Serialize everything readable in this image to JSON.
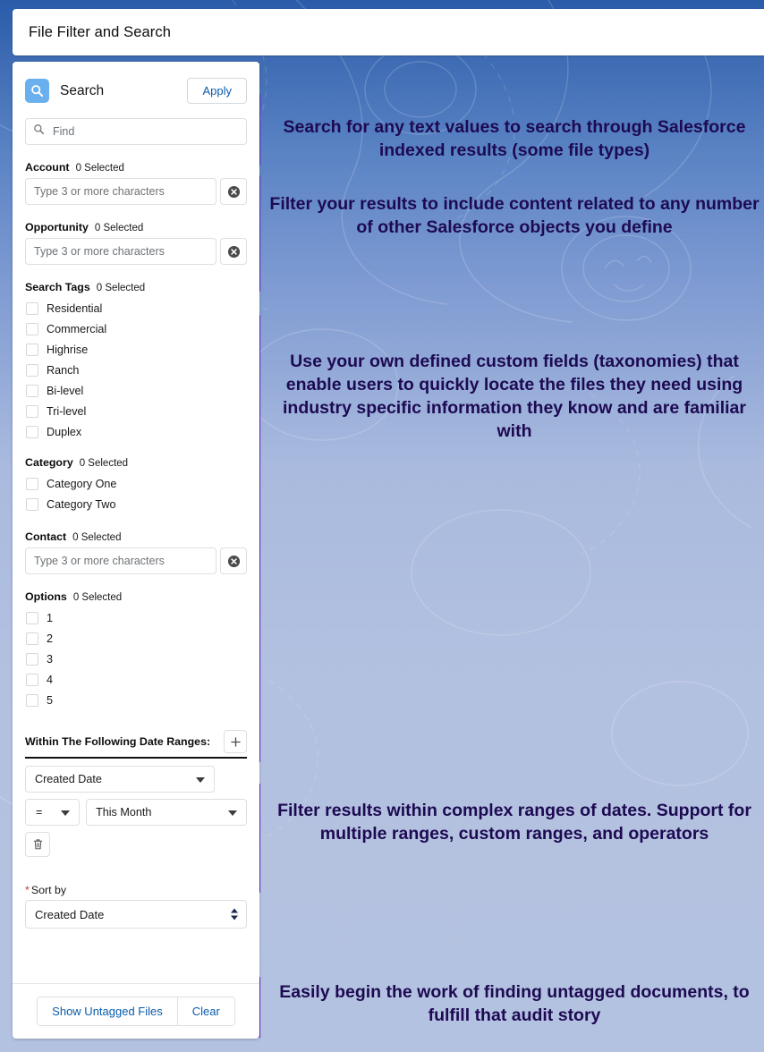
{
  "window": {
    "title": "File Filter and Search"
  },
  "panel": {
    "icon": "search-icon",
    "title": "Search",
    "apply_label": "Apply",
    "find": {
      "placeholder": "Find",
      "value": "",
      "icon": "search-icon"
    },
    "lookups": [
      {
        "key": "account",
        "label": "Account",
        "count": "0 Selected",
        "placeholder": "Type 3 or more characters",
        "value": "",
        "clear_icon": "clear-circle-icon"
      },
      {
        "key": "opportunity",
        "label": "Opportunity",
        "count": "0 Selected",
        "placeholder": "Type 3 or more characters",
        "value": "",
        "clear_icon": "clear-circle-icon"
      }
    ],
    "search_tags": {
      "label": "Search Tags",
      "count": "0 Selected",
      "options": [
        "Residential",
        "Commercial",
        "Highrise",
        "Ranch",
        "Bi-level",
        "Tri-level",
        "Duplex"
      ]
    },
    "category": {
      "label": "Category",
      "count": "0 Selected",
      "options": [
        "Category One",
        "Category Two"
      ]
    },
    "contact": {
      "key": "contact",
      "label": "Contact",
      "count": "0 Selected",
      "placeholder": "Type 3 or more characters",
      "value": "",
      "clear_icon": "clear-circle-icon"
    },
    "options": {
      "label": "Options",
      "count": "0 Selected",
      "options": [
        "1",
        "2",
        "3",
        "4",
        "5"
      ]
    },
    "date_ranges": {
      "title": "Within The Following Date Ranges:",
      "add_icon": "plus-icon",
      "rows": [
        {
          "field": "Created Date",
          "operator": "=",
          "value": "This Month",
          "delete_icon": "trash-icon"
        }
      ]
    },
    "sort_by": {
      "required_mark": "*",
      "label": "Sort by",
      "value": "Created Date",
      "stepper_icon": "up-down-arrows-icon"
    },
    "footer": {
      "show_untagged_label": "Show Untagged Files",
      "clear_label": "Clear"
    }
  },
  "annotations": [
    {
      "id": "anno-search",
      "text": "Search for any text values to search through Salesforce indexed results (some file types)"
    },
    {
      "id": "anno-related-objects",
      "text": "Filter your results to include content related to any number of other Salesforce objects you define"
    },
    {
      "id": "anno-custom-fields",
      "text": "Use your own defined custom fields (taxonomies) that enable users to quickly locate the files they need using industry specific information they know and are familiar with"
    },
    {
      "id": "anno-date-ranges",
      "text": "Filter results within complex ranges of dates. Support for multiple ranges, custom ranges, and operators"
    },
    {
      "id": "anno-untagged",
      "text": "Easily begin the work of finding untagged documents, to fulfill that audit story"
    }
  ],
  "colors": {
    "accent_purple": "#6f21d6",
    "annotation_text": "#1d0a52",
    "link_blue": "#0b5cab",
    "search_badge": "#6ab0ee",
    "required_red": "#c23934"
  }
}
